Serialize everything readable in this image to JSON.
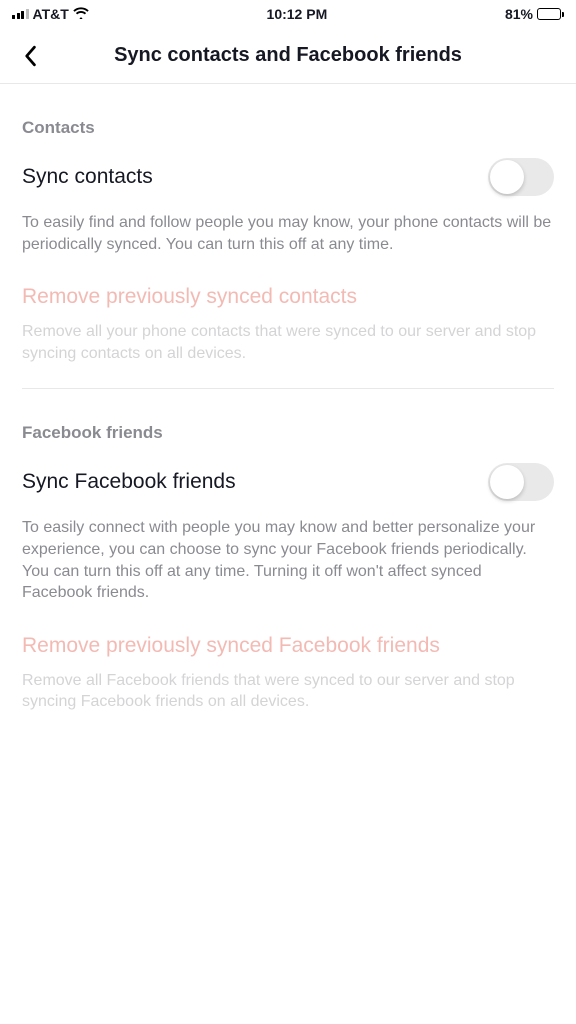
{
  "status": {
    "carrier": "AT&T",
    "time": "10:12 PM",
    "battery_pct": "81%"
  },
  "header": {
    "title": "Sync contacts and Facebook friends"
  },
  "sections": {
    "contacts": {
      "label": "Contacts",
      "toggle_label": "Sync contacts",
      "description": "To easily find and follow people you may know, your phone contacts will be periodically synced. You can turn this off at any time.",
      "remove_title": "Remove previously synced contacts",
      "remove_desc": "Remove all your phone contacts that were synced to our server and stop syncing contacts on all devices."
    },
    "facebook": {
      "label": "Facebook friends",
      "toggle_label": "Sync Facebook friends",
      "description": "To easily connect with people you may know and better personalize your experience, you can choose to sync your Facebook friends periodically. You can turn this off at any time. Turning it off won't affect synced Facebook friends.",
      "remove_title": "Remove previously synced Facebook friends",
      "remove_desc": "Remove all Facebook friends that were synced to our server and stop syncing Facebook friends on all devices."
    }
  }
}
